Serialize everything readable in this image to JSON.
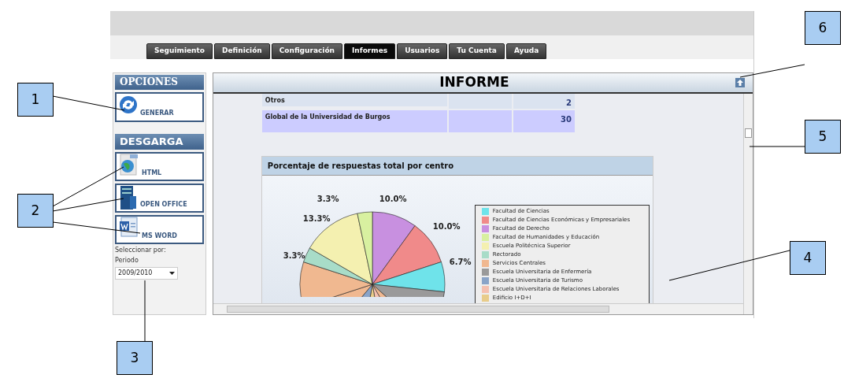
{
  "tabs": [
    {
      "label": "Seguimiento",
      "selected": false
    },
    {
      "label": "Definición",
      "selected": false
    },
    {
      "label": "Configuración",
      "selected": false
    },
    {
      "label": "Informes",
      "selected": true
    },
    {
      "label": "Usuarios",
      "selected": false
    },
    {
      "label": "Tu Cuenta",
      "selected": false
    },
    {
      "label": "Ayuda",
      "selected": false
    }
  ],
  "sidebar": {
    "options_title": "OPCIONES",
    "generate_button": "GENERAR",
    "download_title": "DESGARGA",
    "downloads": [
      {
        "kind": "html",
        "label": "HTML"
      },
      {
        "kind": "office",
        "label": "OPEN OFFICE"
      },
      {
        "kind": "word",
        "label": "MS WORD"
      }
    ],
    "filter_label": "Seleccionar por:",
    "period_label": "Periodo",
    "period_value": "2009/2010"
  },
  "report": {
    "title": "INFORME",
    "table_rows": [
      {
        "name": "Otros",
        "column_2": "",
        "total": "2"
      },
      {
        "name": "Global de la Universidad de Burgos",
        "column_2": "",
        "total": "30"
      }
    ],
    "chart": {
      "title": "Porcentaje de respuestas total por centro",
      "pie_labels": [
        "3.3%",
        "10.0%",
        "13.3%",
        "10.0%",
        "3.3%",
        "6.7%"
      ],
      "legend": [
        {
          "label": "Facultad de Ciencias",
          "color": "#6fe3ea"
        },
        {
          "label": "Facultad de Ciencias Económicas y Empresariales",
          "color": "#f08a8a"
        },
        {
          "label": "Facultad de Derecho",
          "color": "#c890e0"
        },
        {
          "label": "Facultad de Humanidades y Educación",
          "color": "#d8f0a0"
        },
        {
          "label": "Escuela Politécnica Superior",
          "color": "#f4f0b0"
        },
        {
          "label": "Rectorado",
          "color": "#a8dcc8"
        },
        {
          "label": "Servicios Centrales",
          "color": "#f0b890"
        },
        {
          "label": "Escuela Universitaria de Enfermería",
          "color": "#9a9a9a"
        },
        {
          "label": "Escuela Universitaria de Turismo",
          "color": "#8aa4c8"
        },
        {
          "label": "Escuela Universitaria de Relaciones Laborales",
          "color": "#f4c0b0"
        },
        {
          "label": "Edificio I+D+I",
          "color": "#e8cc8a"
        }
      ]
    }
  },
  "callouts": [
    {
      "label": "1"
    },
    {
      "label": "2"
    },
    {
      "label": "3"
    },
    {
      "label": "4"
    },
    {
      "label": "5"
    },
    {
      "label": "6"
    }
  ]
}
